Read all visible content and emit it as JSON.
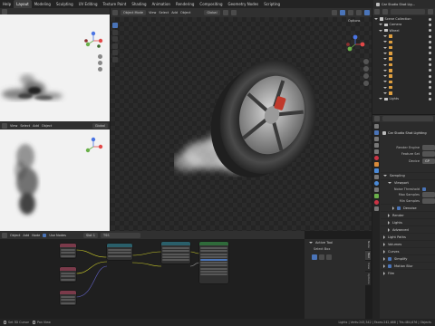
{
  "topbar": {
    "menus": [
      "Help"
    ],
    "workspace_tabs": [
      "Layout",
      "Modeling",
      "Sculpting",
      "UV Editing",
      "Texture Paint",
      "Shading",
      "Animation",
      "Rendering",
      "Compositing",
      "Geometry Nodes",
      "Scripting"
    ],
    "active_tab": "Layout",
    "scene_name": "Car Studio Shot Lig..."
  },
  "viewport": {
    "mode": "Object Mode",
    "menus": [
      "View",
      "Select",
      "Add",
      "Object"
    ],
    "orientation": "Global",
    "options_label": "Options"
  },
  "small_viewport_header": {
    "menus": [
      "View",
      "Select",
      "Add",
      "Object"
    ],
    "shading": "Global"
  },
  "node_editor": {
    "menus": [
      "Object",
      "Add",
      "Node"
    ],
    "use_nodes_label": "Use Nodes",
    "slot_label": "Slot 1",
    "material_name": "TSS",
    "nodes": [
      {
        "title": "",
        "color": "#7a3a4a",
        "kind": "texture"
      },
      {
        "title": "",
        "color": "#7a3a4a",
        "kind": "texture"
      },
      {
        "title": "",
        "color": "#7a3a4a",
        "kind": "texture"
      },
      {
        "title": "",
        "color": "#2a5f6a",
        "kind": "mapping"
      },
      {
        "title": "",
        "color": "#2a5f6a",
        "kind": "mapping"
      },
      {
        "title": "",
        "color": "#2f6a3a",
        "kind": "bsdf"
      }
    ]
  },
  "tool_panel": {
    "title": "Active Tool",
    "tool_name": "Select Box",
    "tabs": [
      "Node",
      "Tool",
      "View",
      "Options"
    ]
  },
  "outliner": {
    "title": "Scene Collection",
    "rows": [
      {
        "label": "Scene Collection",
        "indent": 0,
        "icon_color": "#c8c8c8"
      },
      {
        "label": "Camera",
        "indent": 1,
        "icon_color": "#c8c8c8"
      },
      {
        "label": "Wheel",
        "indent": 1,
        "icon_color": "#c8c8c8"
      },
      {
        "label": "",
        "indent": 2,
        "icon_color": "#e0a040"
      },
      {
        "label": "",
        "indent": 2,
        "icon_color": "#e0a040"
      },
      {
        "label": "",
        "indent": 2,
        "icon_color": "#e0a040"
      },
      {
        "label": "",
        "indent": 2,
        "icon_color": "#e0a040"
      },
      {
        "label": "",
        "indent": 2,
        "icon_color": "#e0a040"
      },
      {
        "label": "",
        "indent": 2,
        "icon_color": "#e0a040"
      },
      {
        "label": "",
        "indent": 2,
        "icon_color": "#e0a040"
      },
      {
        "label": "",
        "indent": 2,
        "icon_color": "#e0a040"
      },
      {
        "label": "",
        "indent": 2,
        "icon_color": "#e0a040"
      },
      {
        "label": "",
        "indent": 2,
        "icon_color": "#e0a040"
      },
      {
        "label": "",
        "indent": 2,
        "icon_color": "#e0a040"
      },
      {
        "label": "Lights",
        "indent": 1,
        "icon_color": "#c8c8c8"
      }
    ]
  },
  "properties": {
    "context_title": "Car Studio Shot Lighting",
    "render_engine_label": "Render Engine",
    "feature_set_label": "Feature Set",
    "device_label": "Device",
    "device_value": "GP",
    "sections": [
      {
        "label": "Sampling",
        "open": true,
        "indent": 0
      },
      {
        "label": "Viewport",
        "open": true,
        "indent": 1
      },
      {
        "label": "Denoise",
        "open": false,
        "indent": 2,
        "checkbox": true
      },
      {
        "label": "Render",
        "open": false,
        "indent": 1
      },
      {
        "label": "Lights",
        "open": false,
        "indent": 1
      },
      {
        "label": "Advanced",
        "open": false,
        "indent": 1
      },
      {
        "label": "Light Paths",
        "open": false,
        "indent": 0
      },
      {
        "label": "Volumes",
        "open": false,
        "indent": 0
      },
      {
        "label": "Curves",
        "open": false,
        "indent": 0
      },
      {
        "label": "Simplify",
        "open": false,
        "indent": 0,
        "checkbox": true
      },
      {
        "label": "Motion Blur",
        "open": false,
        "indent": 0,
        "checkbox": true
      },
      {
        "label": "Film",
        "open": false,
        "indent": 0
      }
    ],
    "noise_threshold_label": "Noise Threshold",
    "max_samples_label": "Max Samples",
    "min_samples_label": "Min Samples"
  },
  "status_bar": {
    "left": "Set 3D Cursor",
    "hint": "Pan View",
    "right": "Lights | Verts:243,542 | Faces:242,688 | Tris:484,676 | Objects"
  },
  "colors": {
    "accent": "#4a74b8",
    "background": "#1d1d1d",
    "panel": "#303030",
    "axis_x": "#e34848",
    "axis_y": "#6ab04a",
    "axis_z": "#4a74e3"
  }
}
